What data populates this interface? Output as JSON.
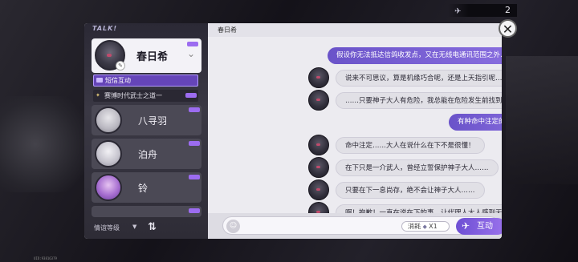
{
  "topbar": {
    "count": "2",
    "icon": "paper-plane-icon"
  },
  "left": {
    "talk_label": "TALK!",
    "current_contact": {
      "name": "春日希"
    },
    "sub_active": {
      "label": "短信互动"
    },
    "sub_item": {
      "label": "赛博时代武士之道一"
    },
    "contacts": [
      {
        "name": "八寻羽"
      },
      {
        "name": "泊舟"
      },
      {
        "name": "铃"
      }
    ],
    "filter_label": "情谊等级",
    "filter_dropdown": "▼",
    "sort_icon": "⇅"
  },
  "chat": {
    "header_name": "春日希",
    "messages": [
      {
        "dir": "out",
        "text": "假设你无法抵达信鸽收发点，又在无线电通讯范围之外……"
      },
      {
        "dir": "in",
        "text": "说来不可思议，算是机缘巧合呢，还是上天指引呢……"
      },
      {
        "dir": "in",
        "text": "……只要神子大人有危险，我总能在危险发生前找到大人。"
      },
      {
        "dir": "out",
        "text": "有种命中注定的感觉呢！"
      },
      {
        "dir": "in",
        "text": "命中注定……大人在说什么在下不是很懂！"
      },
      {
        "dir": "in",
        "text": "在下只是一介武人，曾经立誓保护神子大人……"
      },
      {
        "dir": "in",
        "text": "只要在下一息尚存，绝不会让神子大人……"
      },
      {
        "dir": "in",
        "text": "啊！抱歉！一直在说在下的事，让代理人大人感到无聊了！"
      }
    ]
  },
  "input": {
    "cost_label": "消耗",
    "cost_value": "X1",
    "send_label": "互动"
  },
  "close": {
    "label": "✕"
  },
  "corner_text": "UID:93816379"
}
